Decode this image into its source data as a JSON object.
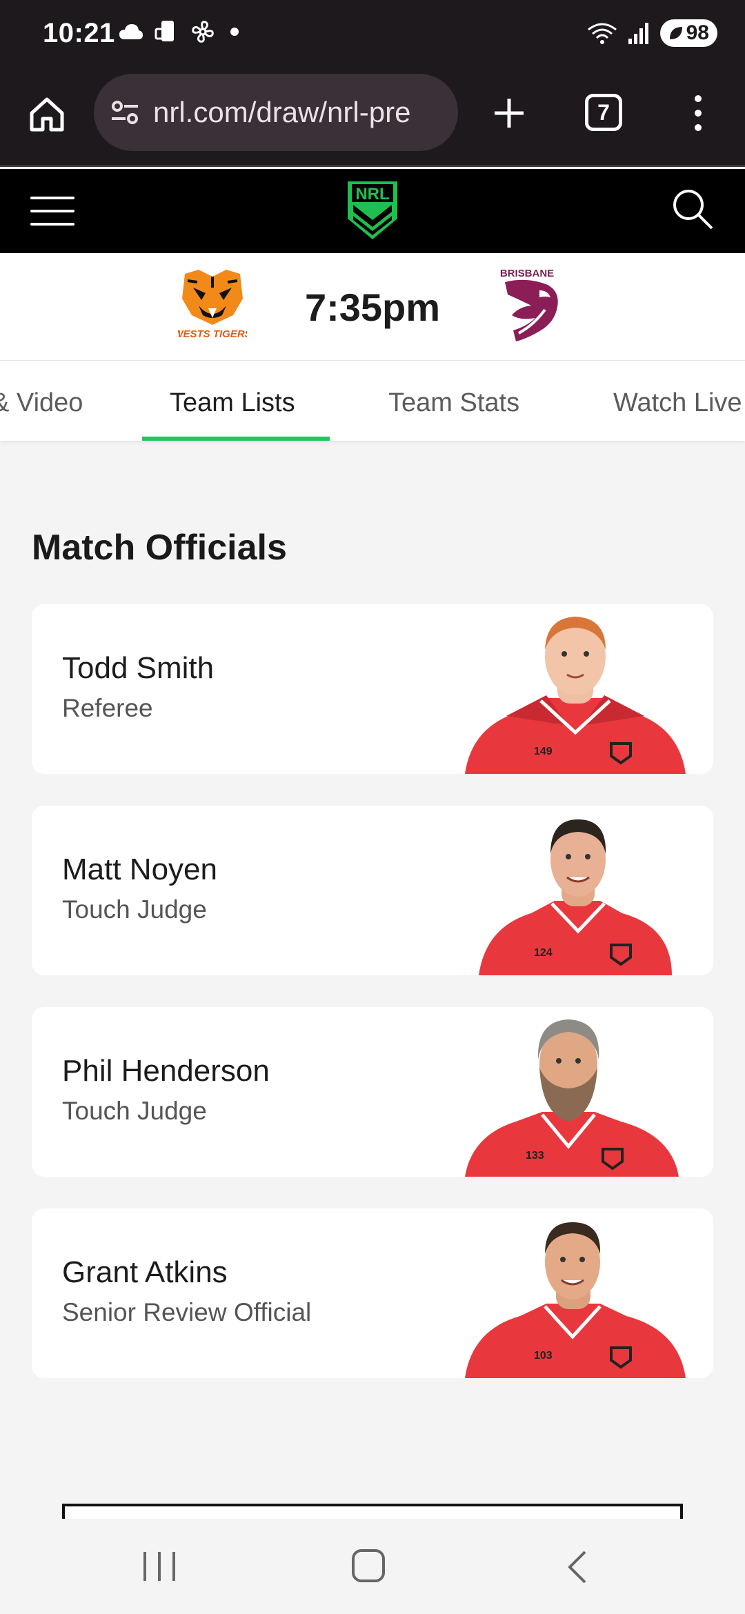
{
  "status_bar": {
    "time": "10:21",
    "battery": "98",
    "left_icons": [
      "cloud-icon",
      "nfc-phone-icon",
      "fan-icon",
      "dot-icon"
    ],
    "right_icons": [
      "wifi-icon",
      "signal-icon",
      "battery-icon"
    ]
  },
  "browser": {
    "url": "nrl.com/draw/nrl-pre",
    "tab_count": "7"
  },
  "site_header": {
    "logo_text": "NRL",
    "brand_color": "#22c55e"
  },
  "match": {
    "time": "7:35pm",
    "home_team": "WESTS TIGERS",
    "away_team": "BRISBANE"
  },
  "tabs": [
    {
      "label": "& Video"
    },
    {
      "label": "Team Lists",
      "active": true
    },
    {
      "label": "Team Stats"
    },
    {
      "label": "Watch Live"
    }
  ],
  "section": {
    "title": "Match Officials"
  },
  "officials": [
    {
      "name": "Todd Smith",
      "role": "Referee",
      "number": "149"
    },
    {
      "name": "Matt Noyen",
      "role": "Touch Judge",
      "number": "124"
    },
    {
      "name": "Phil Henderson",
      "role": "Touch Judge",
      "number": "133"
    },
    {
      "name": "Grant Atkins",
      "role": "Senior Review Official",
      "number": "103"
    }
  ],
  "colors": {
    "accent": "#22c55e",
    "header_bg": "#000000",
    "browser_bg": "#1d191c",
    "jersey_red": "#e8383d"
  }
}
